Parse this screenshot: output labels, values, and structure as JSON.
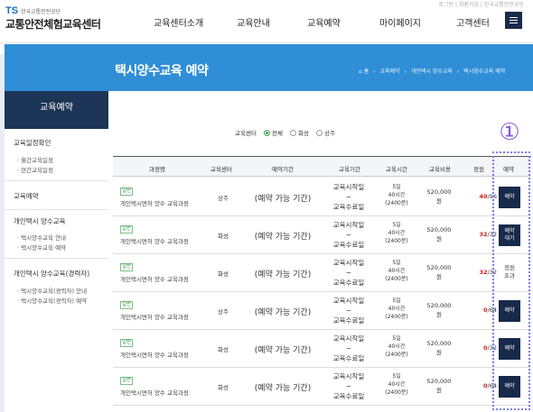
{
  "header": {
    "logo_mark": "TS",
    "logo_sub": "한국교통안전공단",
    "logo_main": "교통안전체험교육센터",
    "util_text": "로그인 | 회원가입 | 한국교통안전공단",
    "nav": [
      "교육센터소개",
      "교육안내",
      "교육예약",
      "마이페이지",
      "고객센터"
    ]
  },
  "banner": {
    "title": "택시양수교육 예약",
    "breadcrumb": [
      "⌂ 홈",
      "›",
      "교육예약",
      "›",
      "개인택시 양수교육",
      "›",
      "택시양수교육 예약"
    ]
  },
  "sidebar": {
    "title": "교육예약",
    "items": [
      {
        "label": "교육일정확인",
        "subs": [
          "· 월간교육일정",
          "· 연간교육일정"
        ]
      },
      {
        "label": "교육예약",
        "subs": []
      },
      {
        "label": "개인택시 양수교육",
        "subs": [
          "· 택시양수교육 안내",
          "· 택시양수교육 예약"
        ]
      },
      {
        "label": "개인택시 양수교육(경력자)",
        "subs": [
          "· 택시양수교육(경력자) 안내",
          "· 택시양수교육(경력자) 예약"
        ]
      }
    ]
  },
  "filter": {
    "label": "교육센터",
    "options": [
      "전체",
      "화성",
      "상주"
    ],
    "selected": "전체"
  },
  "table": {
    "headers": [
      "과정명",
      "교육센터",
      "예약기간",
      "교육기간",
      "교육시간",
      "교육비용",
      "정원",
      "예약"
    ],
    "rows": [
      {
        "badge": "일반",
        "course": "개인택시면허 양수 교육과정",
        "center": "상주",
        "period": "(예약 가능 기간)",
        "edu": [
          "교육시작일",
          "~",
          "교육수료일"
        ],
        "hours": [
          "5일",
          "40시간",
          "(2400분)"
        ],
        "fee": [
          "520,000",
          "원"
        ],
        "cap_current": "40",
        "cap_total": "/96",
        "action": "예약",
        "action_type": "button"
      },
      {
        "badge": "일반",
        "course": "개인택시면허 양수 교육과정",
        "center": "화성",
        "period": "(예약 가능 기간)",
        "edu": [
          "교육시작일",
          "~",
          "교육수료일"
        ],
        "hours": [
          "5일",
          "40시간",
          "(2400분)"
        ],
        "fee": [
          "520,000",
          "원"
        ],
        "cap_current": "32",
        "cap_total": "/32",
        "action": "예약\n대기",
        "action_type": "button"
      },
      {
        "badge": "일반",
        "course": "개인택시면허 양수 교육과정",
        "center": "화성",
        "period": "(예약 가능 기간)",
        "edu": [
          "교육시작일",
          "~",
          "교육수료일"
        ],
        "hours": [
          "5일",
          "40시간",
          "(2400분)"
        ],
        "fee": [
          "520,000",
          "원"
        ],
        "cap_current": "32",
        "cap_total": "/32",
        "action": "정원\n초과",
        "action_type": "text"
      },
      {
        "badge": "일반",
        "course": "개인택시면허 양수 교육과정",
        "center": "상주",
        "period": "(예약 가능 기간)",
        "edu": [
          "교육시작일",
          "~",
          "교육수료일"
        ],
        "hours": [
          "5일",
          "40시간",
          "(2400분)"
        ],
        "fee": [
          "520,000",
          "원"
        ],
        "cap_current": "0",
        "cap_total": "/64",
        "action": "예약",
        "action_type": "button"
      },
      {
        "badge": "일반",
        "course": "개인택시면허 양수 교육과정",
        "center": "화성",
        "period": "(예약 가능 기간)",
        "edu": [
          "교육시작일",
          "~",
          "교육수료일"
        ],
        "hours": [
          "5일",
          "40시간",
          "(2400분)"
        ],
        "fee": [
          "520,000",
          "원"
        ],
        "cap_current": "0",
        "cap_total": "/32",
        "action": "예약",
        "action_type": "button"
      },
      {
        "badge": "일반",
        "course": "개인택시면허 양수 교육과정",
        "center": "화성",
        "period": "(예약 가능 기간)",
        "edu": [
          "교육시작일",
          "~",
          "교육수료일"
        ],
        "hours": [
          "5일",
          "40시간",
          "(2400분)"
        ],
        "fee": [
          "520,000",
          "원"
        ],
        "cap_current": "0",
        "cap_total": "/64",
        "action": "예약",
        "action_type": "button"
      }
    ]
  },
  "annotation": {
    "marker": "①",
    "color": "#7c7ce8"
  },
  "colors": {
    "banner": "#2f8ed6",
    "navy": "#1d3556",
    "accent_red": "#d02020",
    "badge_green": "#3a9a4a"
  }
}
